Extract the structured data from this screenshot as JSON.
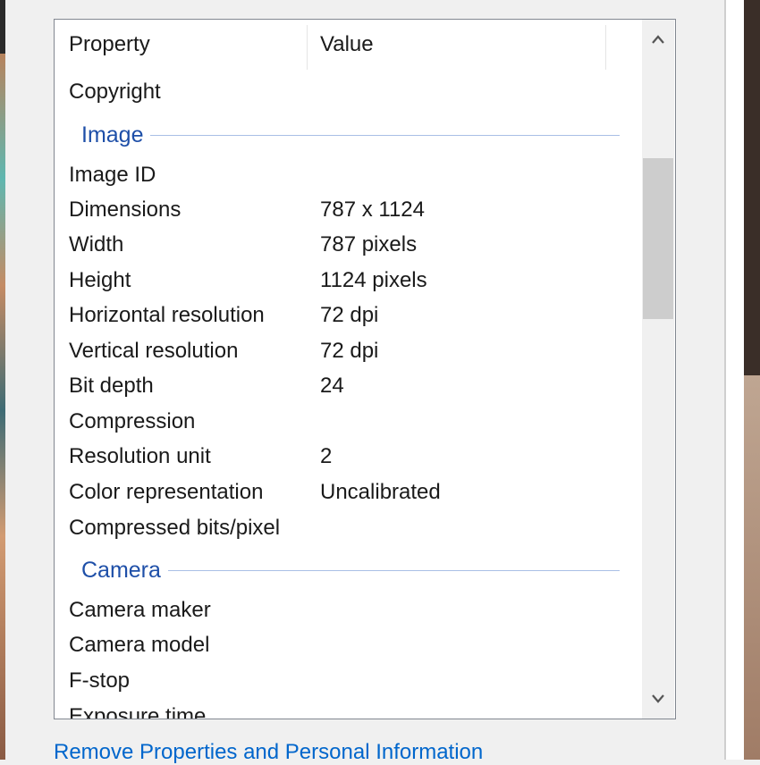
{
  "columns": {
    "property": "Property",
    "value": "Value"
  },
  "rows_top": [
    {
      "property": "Copyright",
      "value": ""
    }
  ],
  "groups": {
    "image": "Image",
    "camera": "Camera"
  },
  "image_rows": [
    {
      "property": "Image ID",
      "value": ""
    },
    {
      "property": "Dimensions",
      "value": "787 x 1124"
    },
    {
      "property": "Width",
      "value": "787 pixels"
    },
    {
      "property": "Height",
      "value": "1124 pixels"
    },
    {
      "property": "Horizontal resolution",
      "value": "72 dpi"
    },
    {
      "property": "Vertical resolution",
      "value": "72 dpi"
    },
    {
      "property": "Bit depth",
      "value": "24"
    },
    {
      "property": "Compression",
      "value": ""
    },
    {
      "property": "Resolution unit",
      "value": "2"
    },
    {
      "property": "Color representation",
      "value": "Uncalibrated"
    },
    {
      "property": "Compressed bits/pixel",
      "value": ""
    }
  ],
  "camera_rows": [
    {
      "property": "Camera maker",
      "value": ""
    },
    {
      "property": "Camera model",
      "value": ""
    },
    {
      "property": "F-stop",
      "value": ""
    },
    {
      "property": "Exposure time",
      "value": ""
    }
  ],
  "footer_link": "Remove Properties and Personal Information",
  "scrollbar": {
    "up_icon": "chevron-up-icon",
    "down_icon": "chevron-down-icon",
    "position": 0.25
  }
}
